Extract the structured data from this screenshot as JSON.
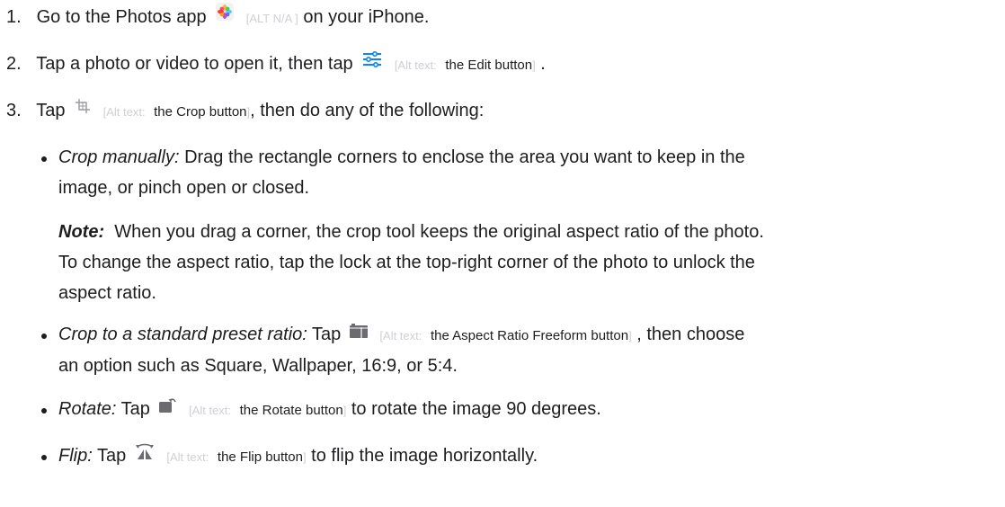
{
  "steps": [
    {
      "number": "1.",
      "text_before": "Go to the Photos app",
      "icon": "photos-app-icon",
      "alt_prefix": "[ALT N/A ]",
      "text_after": "on your iPhone."
    },
    {
      "number": "2.",
      "text_before": "Tap a photo or video to open it, then tap",
      "icon": "edit-sliders-icon",
      "alt_prefix": "[Alt text:",
      "alt_desc": "the Edit button",
      "alt_close": "]",
      "text_after": "."
    },
    {
      "number": "3.",
      "text_before": "Tap",
      "icon": "crop-icon",
      "alt_prefix": "[Alt text:",
      "alt_desc": "the Crop button",
      "alt_close": "]",
      "text_after": ", then do any of the following:"
    }
  ],
  "bullets": {
    "crop_manual": {
      "label": "Crop manually:",
      "line1": " Drag the rectangle corners to enclose the area you want to keep in the",
      "line2": "image, or pinch open or closed."
    },
    "note": {
      "label": "Note:",
      "line1": "  When you drag a corner, the crop tool keeps the original aspect ratio of the photo.",
      "line2": "To change the aspect ratio, tap the lock at the top-right corner of the photo to unlock the",
      "line3": "aspect ratio."
    },
    "preset": {
      "label": "Crop to a standard preset ratio:",
      "text_before": " Tap",
      "icon": "aspect-ratio-icon",
      "alt_prefix": "[Alt text:",
      "alt_desc": "the Aspect Ratio Freeform button",
      "alt_close": "]",
      "text_after": ", then choose",
      "line2": "an option such as Square, Wallpaper, 16:9, or 5:4."
    },
    "rotate": {
      "label": "Rotate:",
      "text_before": " Tap",
      "icon": "rotate-icon",
      "alt_prefix": "[Alt text:",
      "alt_desc": "the Rotate button",
      "alt_close": "]",
      "text_after": "to rotate the image 90 degrees."
    },
    "flip": {
      "label": "Flip:",
      "text_before": " Tap",
      "icon": "flip-icon",
      "alt_prefix": "[Alt text:",
      "alt_desc": "the Flip button",
      "alt_close": "]",
      "text_after": "to flip the image horizontally."
    }
  },
  "colors": {
    "text": "#1d1d1f",
    "alt_muted": "#d0d0d5",
    "edit_icon_blue": "#0a84ff"
  }
}
